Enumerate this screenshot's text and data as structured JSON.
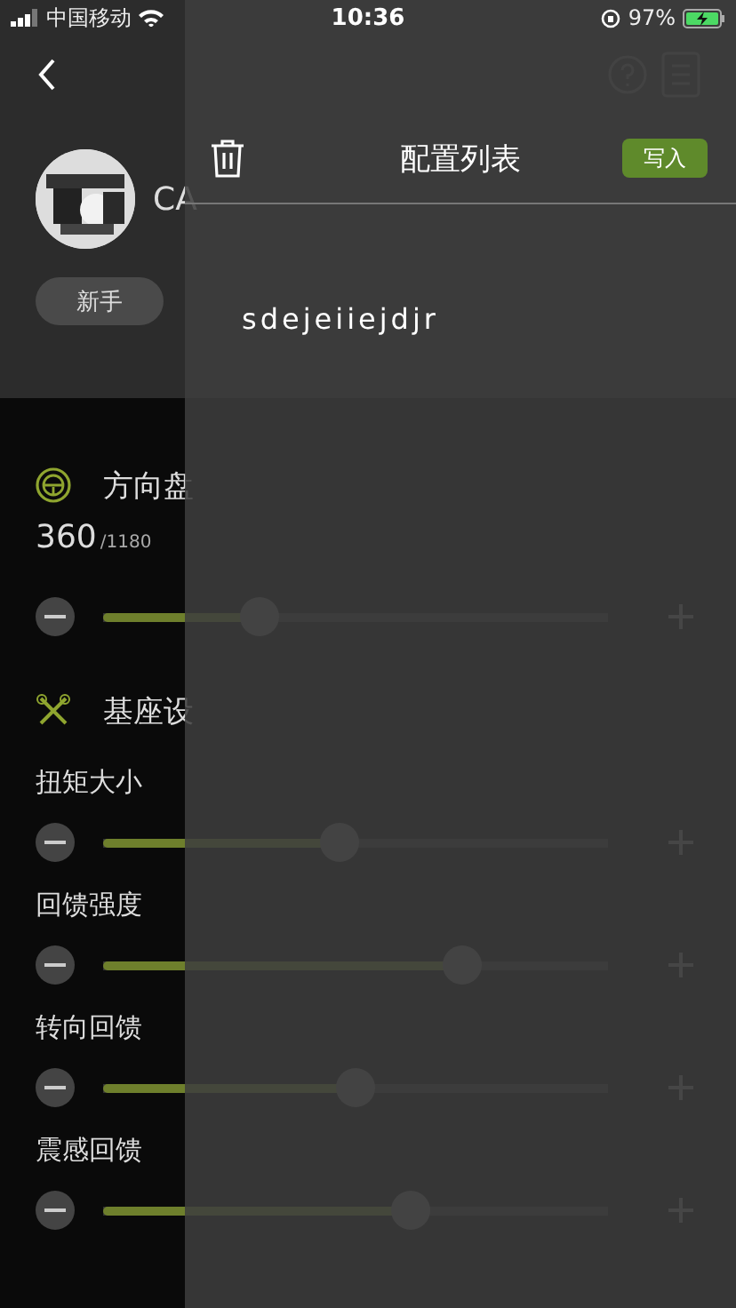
{
  "status_bar": {
    "carrier": "中国移动",
    "time": "10:36",
    "battery": "97%"
  },
  "device": {
    "name": "CA"
  },
  "presets": [
    {
      "label": "新手"
    }
  ],
  "steering": {
    "title": "方向盘",
    "value": "360",
    "max": "/1180",
    "level": 0.31
  },
  "base": {
    "title": "基座设",
    "params": [
      {
        "label": "扭矩大小",
        "level": 0.47
      },
      {
        "label": "回馈强度",
        "level": 0.71
      },
      {
        "label": "转向回馈",
        "level": 0.5
      },
      {
        "label": "震感回馈",
        "level": 0.61
      }
    ]
  },
  "drawer": {
    "title": "配置列表",
    "write_button": "写入",
    "items": [
      {
        "name": "sdejeiiejdjr"
      }
    ]
  }
}
